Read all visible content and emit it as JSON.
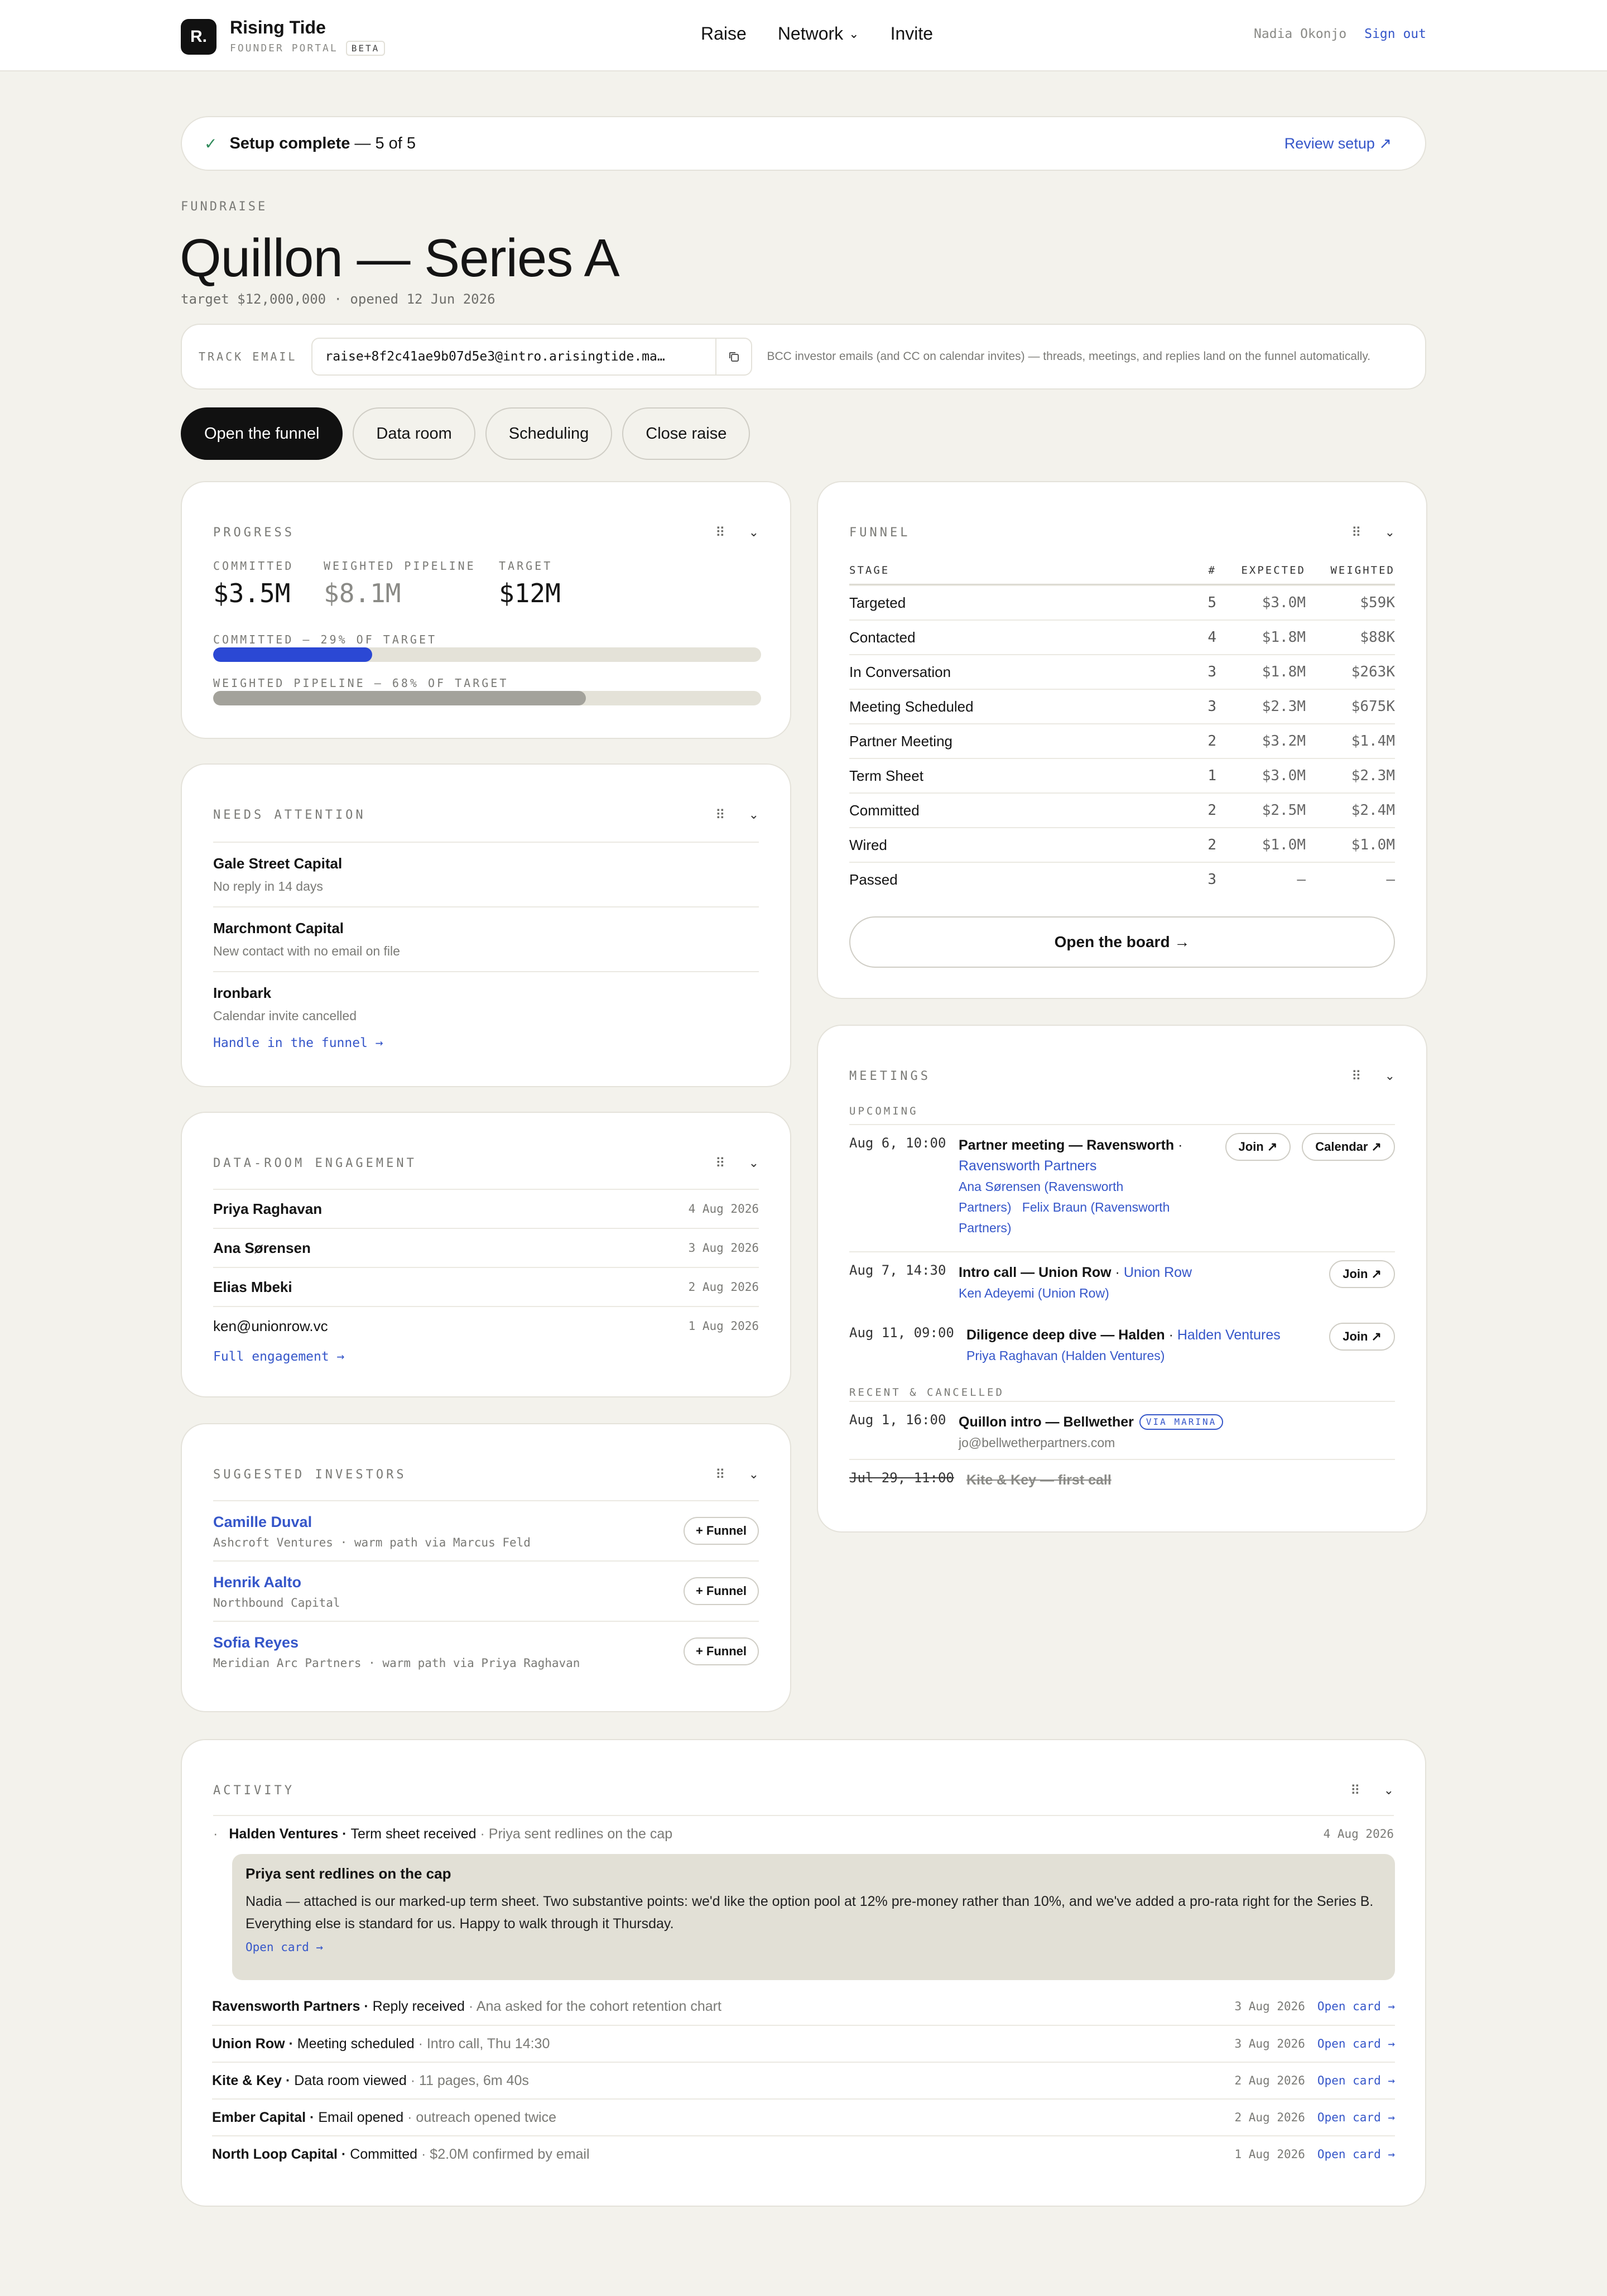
{
  "header": {
    "brand_mark": "R.",
    "brand_name": "Rising Tide",
    "brand_sub": "FOUNDER PORTAL",
    "beta": "BETA",
    "nav": [
      "Raise",
      "Network",
      "Invite"
    ],
    "user_name": "Nadia Okonjo",
    "sign_out": "Sign out"
  },
  "setup": {
    "label": "Setup complete",
    "count": "— 5 of 5",
    "review": "Review setup ↗"
  },
  "page": {
    "eyebrow": "FUNDRAISE",
    "title": "Quillon — Series A",
    "meta": "target $12,000,000 · opened 12 Jun 2026"
  },
  "track": {
    "label": "TRACK EMAIL",
    "value": "raise+8f2c41ae9b07d5e3@intro.arisingtide.ma…",
    "hint": "BCC investor emails (and CC on calendar invites) — threads, meetings, and replies land on the funnel automatically."
  },
  "actions": [
    "Open the funnel",
    "Data room",
    "Scheduling",
    "Close raise"
  ],
  "progress": {
    "title": "PROGRESS",
    "committed_label": "COMMITTED",
    "committed_value": "$3.5M",
    "weighted_label": "WEIGHTED PIPELINE",
    "weighted_value": "$8.1M",
    "target_label": "TARGET",
    "target_value": "$12M",
    "bar1_label": "COMMITTED — 29% OF TARGET",
    "bar1_pct": 29,
    "bar2_label": "WEIGHTED PIPELINE — 68% OF TARGET",
    "bar2_pct": 68,
    "bar1_color": "#2b48d4",
    "bar2_color": "#a3a29b"
  },
  "attention": {
    "title": "NEEDS ATTENTION",
    "items": [
      {
        "name": "Gale Street Capital",
        "desc": "No reply in 14 days"
      },
      {
        "name": "Marchmont Capital",
        "desc": "New contact with no email on file"
      },
      {
        "name": "Ironbark",
        "desc": "Calendar invite cancelled"
      }
    ],
    "link": "Handle in the funnel →"
  },
  "dataroom": {
    "title": "DATA-ROOM ENGAGEMENT",
    "rows": [
      {
        "name": "Priya Raghavan",
        "date": "4 Aug 2026"
      },
      {
        "name": "Ana Sørensen",
        "date": "3 Aug 2026"
      },
      {
        "name": "Elias Mbeki",
        "date": "2 Aug 2026"
      },
      {
        "name": "ken@unionrow.vc",
        "date": "1 Aug 2026"
      }
    ],
    "link": "Full engagement →"
  },
  "suggested": {
    "title": "SUGGESTED INVESTORS",
    "button": "+ Funnel",
    "rows": [
      {
        "name": "Camille Duval",
        "sub": "Ashcroft Ventures · warm path via Marcus Feld"
      },
      {
        "name": "Henrik Aalto",
        "sub": "Northbound Capital"
      },
      {
        "name": "Sofia Reyes",
        "sub": "Meridian Arc Partners · warm path via Priya Raghavan"
      }
    ]
  },
  "funnel": {
    "title": "FUNNEL",
    "headers": {
      "stage": "STAGE",
      "num": "#",
      "expected": "EXPECTED",
      "weighted": "WEIGHTED"
    },
    "rows": [
      {
        "stage": "Targeted",
        "num": "5",
        "expected": "$3.0M",
        "weighted": "$59K"
      },
      {
        "stage": "Contacted",
        "num": "4",
        "expected": "$1.8M",
        "weighted": "$88K"
      },
      {
        "stage": "In Conversation",
        "num": "3",
        "expected": "$1.8M",
        "weighted": "$263K"
      },
      {
        "stage": "Meeting Scheduled",
        "num": "3",
        "expected": "$2.3M",
        "weighted": "$675K"
      },
      {
        "stage": "Partner Meeting",
        "num": "2",
        "expected": "$3.2M",
        "weighted": "$1.4M"
      },
      {
        "stage": "Term Sheet",
        "num": "1",
        "expected": "$3.0M",
        "weighted": "$2.3M"
      },
      {
        "stage": "Committed",
        "num": "2",
        "expected": "$2.5M",
        "weighted": "$2.4M"
      },
      {
        "stage": "Wired",
        "num": "2",
        "expected": "$1.0M",
        "weighted": "$1.0M"
      },
      {
        "stage": "Passed",
        "num": "3",
        "expected": "—",
        "weighted": "—"
      }
    ],
    "board_button": "Open the board →"
  },
  "meetings": {
    "title": "MEETINGS",
    "upcoming_label": "UPCOMING",
    "recent_label": "RECENT & CANCELLED",
    "m1": {
      "time": "Aug 6, 10:00",
      "title": "Partner meeting — Ravensworth",
      "sep": " · ",
      "org": "Ravensworth Partners",
      "p1": "Ana Sørensen (Ravensworth Partners)",
      "p2": "Felix Braun (Ravensworth Partners)",
      "join": "Join ↗",
      "calendar": "Calendar ↗"
    },
    "m2": {
      "time": "Aug 7, 14:30",
      "title": "Intro call — Union Row",
      "sep": " · ",
      "org": "Union Row",
      "p1": "Ken Adeyemi (Union Row)",
      "join": "Join ↗"
    },
    "m3": {
      "time": "Aug 11, 09:00",
      "title": "Diligence deep dive — Halden",
      "sep": " · ",
      "org": "Halden Ventures",
      "p1": "Priya Raghavan (Halden Ventures)",
      "join": "Join ↗"
    },
    "m4": {
      "time": "Aug 1, 16:00",
      "title": "Quillon intro — Bellwether",
      "badge": "VIA MARINA",
      "email": "jo@bellwetherpartners.com"
    },
    "m5": {
      "time": "Jul 29, 11:00",
      "title": "Kite & Key — first call"
    }
  },
  "activity": {
    "title": "ACTIVITY",
    "first": {
      "bullet": "·",
      "org": "Halden Ventures",
      "sep": " · ",
      "event": "Term sheet received",
      "note": " · Priya sent redlines on the cap",
      "date": "4 Aug 2026"
    },
    "quote": {
      "title": "Priya sent redlines on the cap",
      "body": "Nadia — attached is our marked-up term sheet. Two substantive points: we'd like the option pool at 12% pre-money rather than 10%, and we've added a pro-rata right for the Series B. Everything else is standard for us. Happy to walk through it Thursday.",
      "open": "Open card →"
    },
    "rows": [
      {
        "org": "Ravensworth Partners",
        "event": "Reply received",
        "note": " · Ana asked for the cohort retention chart",
        "date": "3 Aug 2026",
        "open": "Open card →"
      },
      {
        "org": "Union Row",
        "event": "Meeting scheduled",
        "note": " · Intro call, Thu 14:30",
        "date": "3 Aug 2026",
        "open": "Open card →"
      },
      {
        "org": "Kite & Key",
        "event": "Data room viewed",
        "note": " · 11 pages, 6m 40s",
        "date": "2 Aug 2026",
        "open": "Open card →"
      },
      {
        "org": "Ember Capital",
        "event": "Email opened",
        "note": " · outreach opened twice",
        "date": "2 Aug 2026",
        "open": "Open card →"
      },
      {
        "org": "North Loop Capital",
        "event": "Committed",
        "note": " · $2.0M confirmed by email",
        "date": "1 Aug 2026",
        "open": "Open card →"
      }
    ]
  }
}
